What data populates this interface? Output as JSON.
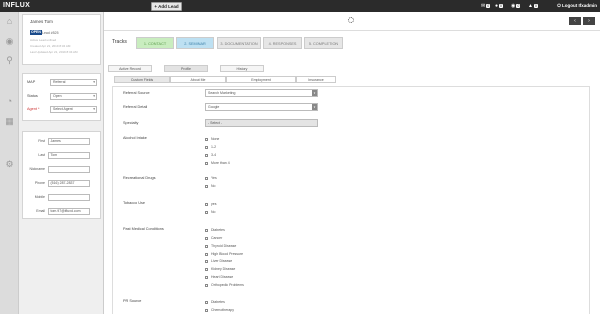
{
  "topbar": {
    "logo": "INFLUX",
    "add_lead": "Add Lead",
    "indicators": [
      {
        "icon": "mail-icon",
        "glyph": "✉",
        "count": "0"
      },
      {
        "icon": "chat-icon",
        "glyph": "●",
        "count": "0"
      },
      {
        "icon": "users-icon",
        "glyph": "◉",
        "count": "0"
      },
      {
        "icon": "alert-icon",
        "glyph": "▲",
        "count": "0"
      }
    ],
    "logout": "Logout Ifxadmin"
  },
  "lead": {
    "name": "James Tom",
    "status_badge": "OPEN",
    "lead_number": "Lead #525",
    "meta_lines": [
      "Active Lead unfixed",
      "Created Apr 21, 2019 8:34 AM",
      "Last Updated Apr 21, 2019 8:34 AM"
    ]
  },
  "left_fields": [
    {
      "label": "MAP",
      "value": "Referral",
      "required": false
    },
    {
      "label": "Status",
      "value": "Open",
      "required": false
    },
    {
      "label": "Agent *",
      "value": "Select Agent",
      "required": true
    }
  ],
  "contact": [
    {
      "label": "First",
      "value": "James"
    },
    {
      "label": "Last",
      "value": "Tom"
    },
    {
      "label": "Nickname",
      "value": ""
    },
    {
      "label": "Phone",
      "value": "(516) 287-2837"
    },
    {
      "label": "Mobile",
      "value": ""
    },
    {
      "label": "Email",
      "value": "tom.97@ifluxd.com"
    }
  ],
  "tracks": {
    "label": "Tracks",
    "steps": [
      {
        "label": "1. CONTACT",
        "state": "done",
        "color": "#c9edbf"
      },
      {
        "label": "2. SEMINAR",
        "state": "active",
        "color": "#bde0f2"
      },
      {
        "label": "3. DOCUMENTATION",
        "state": "pending",
        "color": "#e6e6e6"
      },
      {
        "label": "4. RESPONSES",
        "state": "pending",
        "color": "#e6e6e6"
      },
      {
        "label": "5. COMPLETION",
        "state": "pending",
        "color": "#e6e6e6"
      }
    ]
  },
  "main_tabs": [
    "Active Record",
    "Profile",
    "History"
  ],
  "main_tab_active": "Profile",
  "sub_tabs": [
    "Custom Fields",
    "About Me",
    "Employment",
    "Insurance"
  ],
  "sub_tab_active": "Custom Fields",
  "form": {
    "referral_source": {
      "label": "Referral Source",
      "value": "Search Marketing"
    },
    "referral_detail": {
      "label": "Referral Detail",
      "value": "Google"
    },
    "specialty": {
      "label": "Specialty",
      "value": "- Select -"
    },
    "alcohol_intake": {
      "label": "Alcohol Intake",
      "options": [
        "None",
        "1-2",
        "3-4",
        "More than 4"
      ]
    },
    "recreational_drugs": {
      "label": "Recreational Drugs",
      "options": [
        "Yes",
        "No"
      ]
    },
    "tobacco_use": {
      "label": "Tobacco Use",
      "options": [
        "yes",
        "No"
      ]
    },
    "past_medical": {
      "label": "Past Medical Conditions",
      "options": [
        "Diabetes",
        "Cancer",
        "Thyroid Disease",
        "High Blood Pressure",
        "Liver Disease",
        "Kidney Disease",
        "Heart Disease",
        "Orthopedic Problems"
      ]
    },
    "pr_source": {
      "label": "PR Source",
      "options": [
        "Diabetes",
        "Chemotherapy"
      ]
    }
  }
}
